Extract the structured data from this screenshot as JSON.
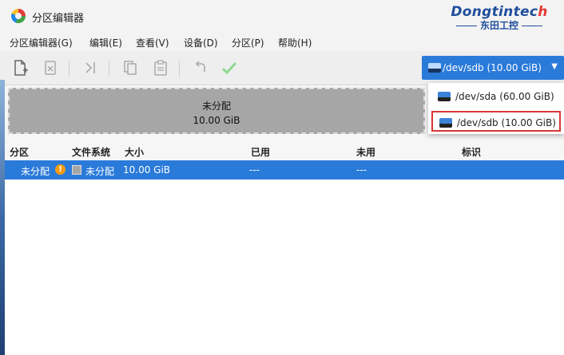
{
  "window": {
    "title": "分区编辑器"
  },
  "brand": {
    "name_en_main": "Dongtintec",
    "name_en_tail": "h",
    "name_cn": "东田工控"
  },
  "menu": [
    {
      "label": "分区编辑器(G)"
    },
    {
      "label": "编辑(E)"
    },
    {
      "label": "查看(V)"
    },
    {
      "label": "设备(D)"
    },
    {
      "label": "分区(P)"
    },
    {
      "label": "帮助(H)"
    }
  ],
  "toolbar": {
    "buttons": [
      "new-partition-icon",
      "delete-partition-icon",
      "resize-move-icon",
      "copy-icon",
      "paste-icon",
      "undo-icon",
      "apply-icon"
    ]
  },
  "device_selector": {
    "selected": "/dev/sdb (10.00 GiB)",
    "options": [
      "/dev/sda (60.00 GiB)",
      "/dev/sdb (10.00 GiB)"
    ]
  },
  "graph": {
    "label": "未分配",
    "size": "10.00 GiB"
  },
  "table": {
    "headers": [
      "分区",
      "文件系统",
      "大小",
      "已用",
      "未用",
      "标识"
    ],
    "rows": [
      {
        "partition": "未分配",
        "filesystem": "未分配",
        "size": "10.00 GiB",
        "used": "---",
        "unused": "---",
        "flags": ""
      }
    ]
  },
  "colors": {
    "accent": "#2a7ad9",
    "unallocated": "#a6a6a6",
    "warning": "#f39c12",
    "highlight_border": "#d93636"
  }
}
